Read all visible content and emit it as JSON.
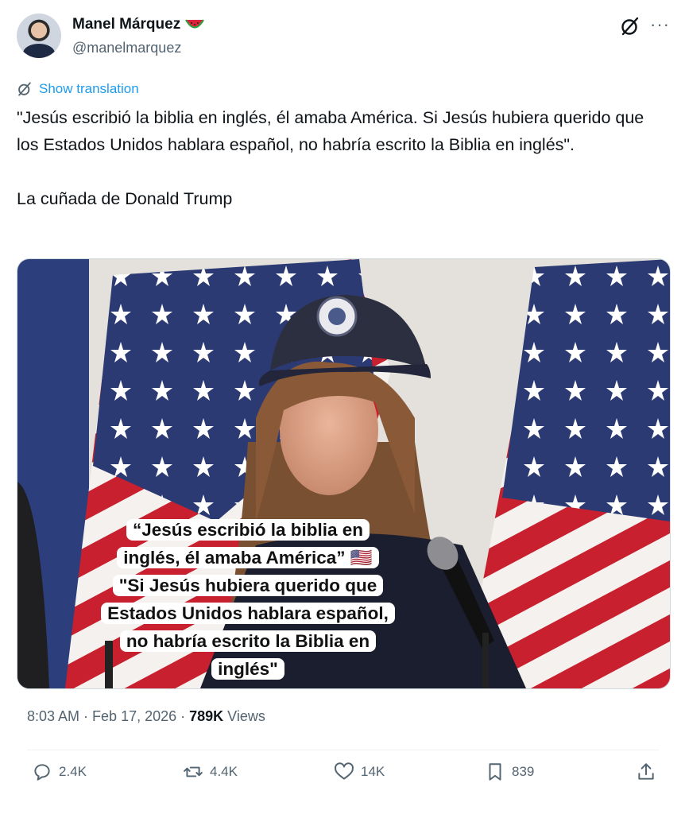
{
  "author": {
    "name": "Manel Márquez",
    "handle": "@manelmarquez",
    "name_emoji": "watermelon-icon"
  },
  "translate_label": "Show translation",
  "tweet": {
    "paragraph1": "\"Jesús escribió la biblia en inglés, él amaba América. Si Jesús hubiera querido que los Estados Unidos hablara español, no habría escrito la Biblia en inglés\".",
    "paragraph2": "La cuñada de Donald Trump"
  },
  "media_caption": {
    "line1": "“Jesús escribió la biblia en",
    "line2": "inglés, él amaba América” 🇺🇸",
    "line3": "\"Si Jesús hubiera querido que",
    "line4": "Estados Unidos hablara español,",
    "line5": "no habría escrito la Biblia en",
    "line6": "inglés\""
  },
  "meta": {
    "time": "8:03 AM",
    "sep1": " · ",
    "date": "Feb 17, 2026",
    "sep2": " · ",
    "views_count": "789K",
    "views_label": " Views"
  },
  "actions": {
    "replies": "2.4K",
    "reposts": "4.4K",
    "likes": "14K",
    "bookmarks": "839"
  },
  "colors": {
    "accent": "#1d9bf0",
    "muted": "#536471",
    "text": "#0f1419"
  }
}
